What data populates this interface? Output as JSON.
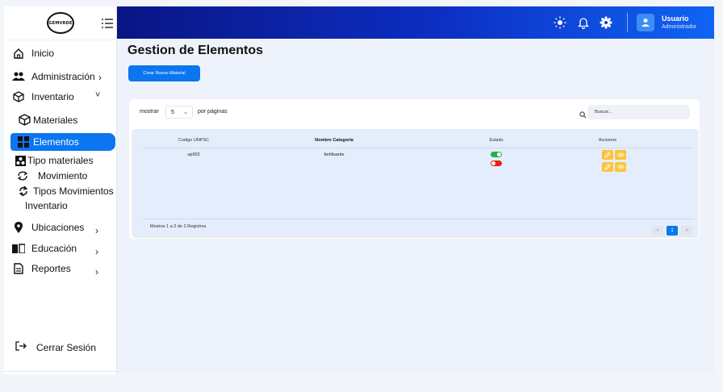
{
  "sidebar": {
    "logo_text": "GEMVRDE",
    "items": [
      {
        "label": "Inicio",
        "icon": "home-icon"
      },
      {
        "label": "Administración",
        "icon": "users-icon",
        "chevron": "›"
      },
      {
        "label": "Inventario",
        "icon": "box-icon",
        "chevron": "˅"
      },
      {
        "label": "Materiales",
        "icon": "box-icon"
      },
      {
        "label": "Elementos",
        "icon": "grid-icon"
      },
      {
        "label": "Tipo materiales",
        "icon": "materials-icon"
      },
      {
        "label": "Movimiento",
        "icon": "refresh-icon"
      },
      {
        "label": "Tipos Movimientos",
        "label2": "Inventario",
        "icon": "sync-icon"
      },
      {
        "label": "Ubicaciones",
        "icon": "location-icon",
        "chevron": "›"
      },
      {
        "label": "Educación",
        "icon": "book-icon",
        "chevron": "›"
      },
      {
        "label": "Reportes",
        "icon": "document-icon",
        "chevron": "›"
      }
    ],
    "logout_label": "Cerrar Sesión"
  },
  "header": {
    "user_name": "Usuario",
    "user_role": "Administrador"
  },
  "main": {
    "title": "Gestion de Elementos",
    "create_button": "Crear Nuevo Material",
    "show_label": "mostrar",
    "page_size": "5",
    "per_page_label": "por páginas",
    "search_placeholder": "Buscar...",
    "columns": [
      "Codigo UNPSC",
      "Nombre Categoria",
      "Estado",
      "Acciones"
    ],
    "rows": [
      {
        "codigo": "up002",
        "nombre": "fertilisante"
      }
    ],
    "status_toggles": [
      {
        "state": "on",
        "color": "#22b14c"
      },
      {
        "state": "off",
        "color": "#e81c1c"
      }
    ],
    "records_text": "Mostrar 1 a 2 de 2 Registros",
    "pagination": {
      "prev": "‹",
      "current": "1",
      "next": "›"
    }
  },
  "colors": {
    "accent": "#0b76f0",
    "header_start": "#0a1585",
    "header_end": "#0f64f2",
    "action_yellow": "#fbc43a"
  }
}
